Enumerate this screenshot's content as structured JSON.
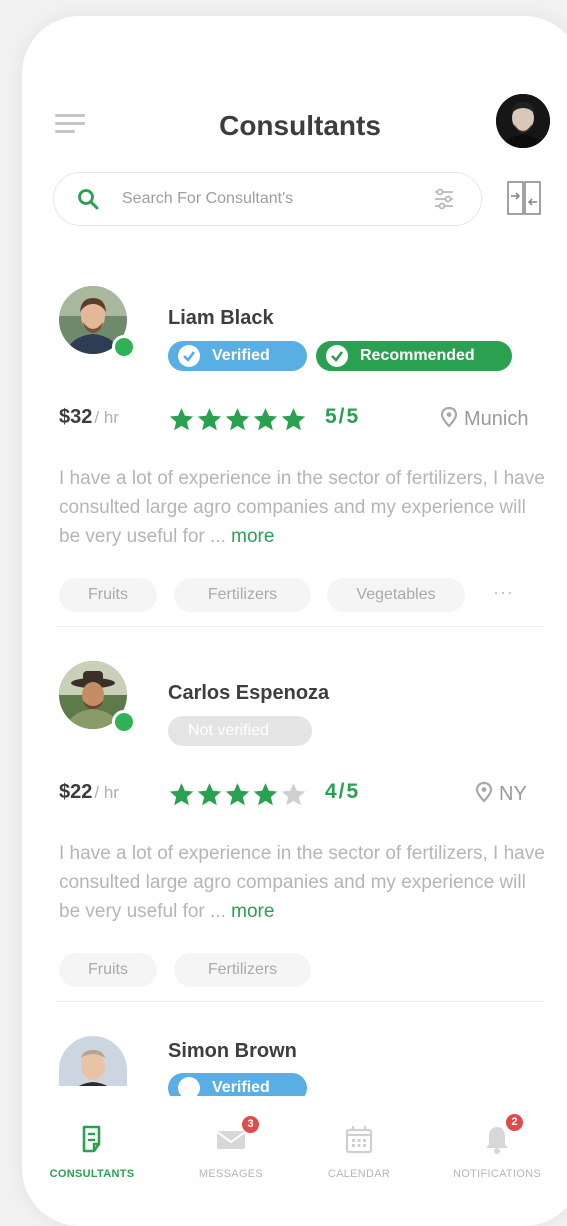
{
  "header": {
    "title": "Consultants"
  },
  "search": {
    "placeholder": "Search For Consultant's"
  },
  "colors": {
    "accent": "#2aa151",
    "verified": "#59aee3",
    "badge": "#e24b4b"
  },
  "consultants": [
    {
      "name": "Liam Black",
      "badges": [
        "Verified",
        "Recommended"
      ],
      "price": "$32",
      "unit": "/ hr",
      "stars": 5,
      "rating": "5/5",
      "location": "Munich",
      "description": "I have a lot of experience in the sector of fertilizers, I have consulted large agro companies and my experience will be very useful for ...",
      "more": "more",
      "tags": [
        "Fruits",
        "Fertilizers",
        "Vegetables"
      ],
      "tags_more": "···"
    },
    {
      "name": "Carlos Espenoza",
      "badges": [
        "Not verified"
      ],
      "price": "$22",
      "unit": "/ hr",
      "stars": 4,
      "rating": "4/5",
      "location": "NY",
      "description": "I have a lot of experience in the sector of fertilizers, I have consulted large agro companies and my experience will be very useful for ...",
      "more": "more",
      "tags": [
        "Fruits",
        "Fertilizers"
      ]
    },
    {
      "name": "Simon Brown",
      "badges": [
        "Verified"
      ]
    }
  ],
  "tabbar": {
    "items": [
      {
        "label": "CONSULTANTS",
        "icon": "document-icon",
        "active": true
      },
      {
        "label": "MESSAGES",
        "icon": "mail-icon",
        "count": "3"
      },
      {
        "label": "CALENDAR",
        "icon": "calendar-icon"
      },
      {
        "label": "NOTIFICATIONS",
        "icon": "bell-icon",
        "count": "2"
      }
    ]
  }
}
